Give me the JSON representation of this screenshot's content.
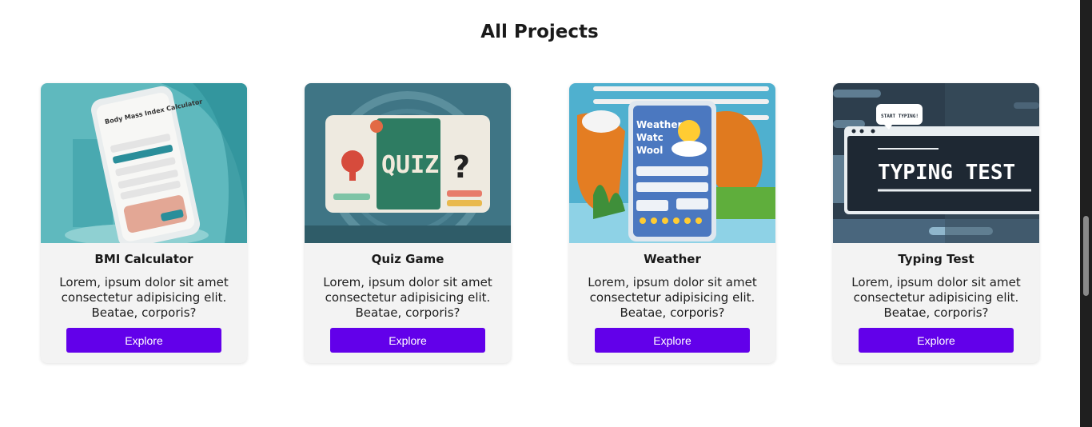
{
  "page": {
    "title": "All Projects"
  },
  "projects": [
    {
      "name": "BMI Calculator",
      "description": "Lorem, ipsum dolor sit amet consectetur adipisicing elit. Beatae, corporis?",
      "button": "Explore",
      "image_icon": "bmi-phone-illustration",
      "image_text": "Body Mass Index Calculator"
    },
    {
      "name": "Quiz Game",
      "description": "Lorem, ipsum dolor sit amet consectetur adipisicing elit. Beatae, corporis?",
      "button": "Explore",
      "image_icon": "quiz-board-illustration",
      "image_text": "QUIZ"
    },
    {
      "name": "Weather",
      "description": "Lorem, ipsum dolor sit amet consectetur adipisicing elit. Beatae, corporis?",
      "button": "Explore",
      "image_icon": "weather-panel-illustration",
      "image_text": "Weather Watc Wool"
    },
    {
      "name": "Typing Test",
      "description": "Lorem, ipsum dolor sit amet consectetur adipisicing elit. Beatae, corporis?",
      "button": "Explore",
      "image_icon": "typing-window-illustration",
      "image_text": "TYPING TEST",
      "image_bubble": "START TYPING!"
    }
  ],
  "colors": {
    "button": "#6200ea",
    "card": "#f3f3f3"
  }
}
